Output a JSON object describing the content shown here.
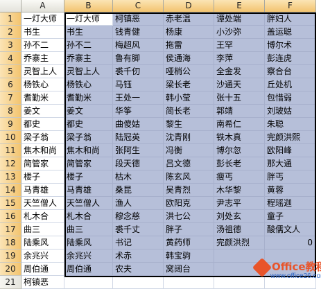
{
  "columns": [
    "A",
    "B",
    "C",
    "D",
    "E",
    "F"
  ],
  "rows": [
    {
      "n": "1",
      "cells": [
        "一灯大师",
        "一灯大师",
        "柯镇恶",
        "赤老温",
        "谭处端",
        "胖妇人"
      ]
    },
    {
      "n": "2",
      "cells": [
        "书生",
        "书生",
        "钱青健",
        "杨康",
        "小沙弥",
        "盖运聪"
      ]
    },
    {
      "n": "3",
      "cells": [
        "孙不二",
        "孙不二",
        "梅超风",
        "拖雷",
        "王罕",
        "博尔术"
      ]
    },
    {
      "n": "4",
      "cells": [
        "乔寨主",
        "乔寨主",
        "鲁有脚",
        "侯通海",
        "李萍",
        "彭连虎"
      ]
    },
    {
      "n": "5",
      "cells": [
        "灵智上人",
        "灵智上人",
        "裘千仞",
        "哑梢公",
        "全金发",
        "察合台"
      ]
    },
    {
      "n": "6",
      "cells": [
        "杨铁心",
        "杨铁心",
        "马钰",
        "梁长老",
        "沙通天",
        "丘处机"
      ]
    },
    {
      "n": "7",
      "cells": [
        "耆勤米",
        "耆勤米",
        "王处一",
        "韩小莹",
        "张十五",
        "包惜弱"
      ]
    },
    {
      "n": "8",
      "cells": [
        "姜文",
        "姜文",
        "华筝",
        "简长老",
        "郭靖",
        "刘玻姑"
      ]
    },
    {
      "n": "9",
      "cells": [
        "都史",
        "都史",
        "曲傻姑",
        "黎生",
        "南希仁",
        "朱聪"
      ]
    },
    {
      "n": "10",
      "cells": [
        "梁子翁",
        "梁子翁",
        "陆冠英",
        "沈青刚",
        "铁木真",
        "完颜洪熙"
      ]
    },
    {
      "n": "11",
      "cells": [
        "焦木和尚",
        "焦木和尚",
        "张阿生",
        "冯衡",
        "博尔忽",
        "欧阳峰"
      ]
    },
    {
      "n": "12",
      "cells": [
        "简管家",
        "简管家",
        "段天德",
        "吕文德",
        "彭长老",
        "那大通"
      ]
    },
    {
      "n": "13",
      "cells": [
        "楼子",
        "楼子",
        "枯木",
        "陈玄风",
        "瘦丐",
        "胖丐"
      ]
    },
    {
      "n": "14",
      "cells": [
        "马青雄",
        "马青雄",
        "桑昆",
        "吴青烈",
        "木华黎",
        "黄蓉"
      ]
    },
    {
      "n": "15",
      "cells": [
        "天竺僧人",
        "天竺僧人",
        "渔人",
        "欧阳克",
        "尹志平",
        "程瑶迦"
      ]
    },
    {
      "n": "16",
      "cells": [
        "札木合",
        "札木合",
        "穆念慈",
        "洪七公",
        "刘处玄",
        "童子"
      ]
    },
    {
      "n": "17",
      "cells": [
        "曲三",
        "曲三",
        "裘千丈",
        "胖子",
        "汤祖德",
        "酸儒文人"
      ]
    },
    {
      "n": "18",
      "cells": [
        "陆乘风",
        "陆乘风",
        "书记",
        "黄药师",
        "完颜洪烈",
        "0"
      ]
    },
    {
      "n": "19",
      "cells": [
        "余兆兴",
        "余兆兴",
        "术赤",
        "韩宝驹",
        "",
        ""
      ]
    },
    {
      "n": "20",
      "cells": [
        "周伯通",
        "周伯通",
        "农夫",
        "窝阔台",
        "",
        ""
      ]
    },
    {
      "n": "21",
      "cells": [
        "柯镇恶",
        "",
        "",
        "",
        "",
        ""
      ]
    }
  ],
  "watermark": {
    "title": "Office教程网",
    "url": "www.office26.com",
    "icon": "office-logo-icon",
    "color": "#e8542a"
  },
  "colors": {
    "selection_fill": "#b6bfd9",
    "header_selected": "#f3c46f"
  }
}
